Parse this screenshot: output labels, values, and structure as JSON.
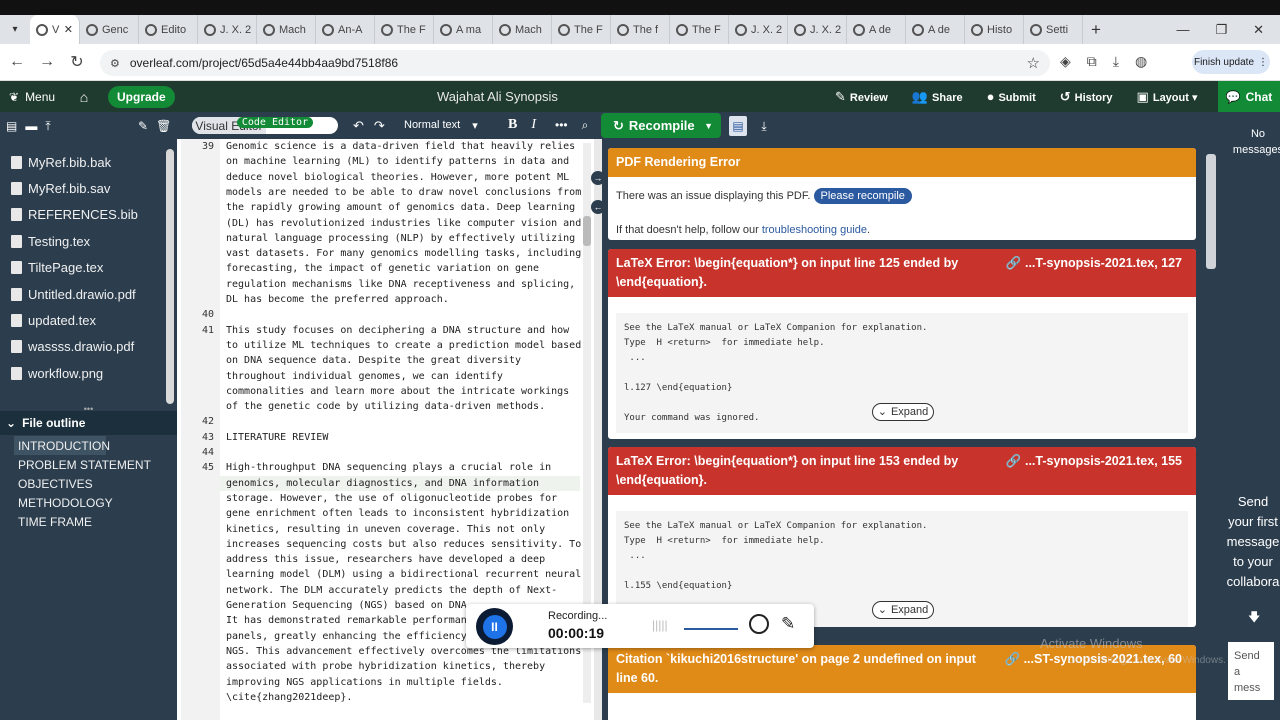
{
  "browser": {
    "tabs": [
      {
        "label": "V",
        "active": true
      },
      {
        "label": "Genc"
      },
      {
        "label": "Edito"
      },
      {
        "label": "J. X. 2"
      },
      {
        "label": "Mach"
      },
      {
        "label": "An-A"
      },
      {
        "label": "The F"
      },
      {
        "label": "A ma"
      },
      {
        "label": "Mach"
      },
      {
        "label": "The F"
      },
      {
        "label": "The f"
      },
      {
        "label": "The F"
      },
      {
        "label": "J. X. 2"
      },
      {
        "label": "J. X. 2"
      },
      {
        "label": "A de"
      },
      {
        "label": "A de"
      },
      {
        "label": "Histo"
      },
      {
        "label": "Setti"
      }
    ],
    "url": "overleaf.com/project/65d5a4e44bb4aa9bd7518f86",
    "finish_update": "Finish update"
  },
  "toolbar": {
    "menu": "Menu",
    "upgrade": "Upgrade",
    "project_title": "Wajahat Ali Synopsis",
    "review": "Review",
    "share": "Share",
    "submit": "Submit",
    "history": "History",
    "layout": "Layout",
    "chat": "Chat"
  },
  "subtoolbar": {
    "code_editor": "Code Editor",
    "visual_editor": "Visual Editor",
    "normal_text": "Normal text",
    "bold": "B",
    "italic": "I",
    "recompile": "Recompile"
  },
  "files": [
    "MyRef.bib.bak",
    "MyRef.bib.sav",
    "REFERENCES.bib",
    "Testing.tex",
    "TiltePage.tex",
    "Untitled.drawio.pdf",
    "updated.tex",
    "wassss.drawio.pdf",
    "workflow.png"
  ],
  "outline": {
    "title": "File outline",
    "items": [
      "INTRODUCTION",
      "PROBLEM STATEMENT",
      "OBJECTIVES",
      "METHODOLOGY",
      "TIME FRAME"
    ]
  },
  "editor": {
    "lines": [
      {
        "n": "39",
        "t": "Genomic science is a data-driven field that heavily relies"
      },
      {
        "n": "",
        "t": "on machine learning (ML) to identify patterns in data and"
      },
      {
        "n": "",
        "t": "deduce novel biological theories. However, more potent ML"
      },
      {
        "n": "",
        "t": "models are needed to be able to draw novel conclusions from"
      },
      {
        "n": "",
        "t": "the rapidly growing amount of genomics data. Deep learning"
      },
      {
        "n": "",
        "t": "(DL) has revolutionized industries like computer vision and"
      },
      {
        "n": "",
        "t": "natural language processing (NLP) by effectively utilizing"
      },
      {
        "n": "",
        "t": "vast datasets. For many genomics modelling tasks, including"
      },
      {
        "n": "",
        "t": "forecasting, the impact of genetic variation on gene"
      },
      {
        "n": "",
        "t": "regulation mechanisms like DNA receptiveness and splicing,"
      },
      {
        "n": "",
        "t": "DL has become the preferred approach."
      },
      {
        "n": "40",
        "t": ""
      },
      {
        "n": "41",
        "t": "This study focuses on deciphering a DNA structure and how"
      },
      {
        "n": "",
        "t": "to utilize ML techniques to create a prediction model based"
      },
      {
        "n": "",
        "t": "on DNA sequence data. Despite the great diversity"
      },
      {
        "n": "",
        "t": "throughout individual genomes, we can identify"
      },
      {
        "n": "",
        "t": "commonalities and learn more about the intricate workings"
      },
      {
        "n": "",
        "t": "of the genetic code by utilizing data-driven methods."
      },
      {
        "n": "42",
        "t": ""
      },
      {
        "n": "43",
        "t": "LITERATURE REVIEW"
      },
      {
        "n": "44",
        "t": ""
      },
      {
        "n": "45",
        "t": "High-throughput DNA sequencing plays a crucial role in"
      },
      {
        "n": "",
        "t": "genomics, molecular diagnostics, and DNA information"
      },
      {
        "n": "",
        "t": "storage. However, the use of oligonucleotide probes for"
      },
      {
        "n": "",
        "t": "gene enrichment often leads to inconsistent hybridization"
      },
      {
        "n": "",
        "t": "kinetics, resulting in uneven coverage. This not only"
      },
      {
        "n": "",
        "t": "increases sequencing costs but also reduces sensitivity. To"
      },
      {
        "n": "",
        "t": "address this issue, researchers have developed a deep"
      },
      {
        "n": "",
        "t": "learning model (DLM) using a bidirectional recurrent neural"
      },
      {
        "n": "",
        "t": "network. The DLM accurately predicts the depth of Next-"
      },
      {
        "n": "",
        "t": "Generation Sequencing (NGS) based on DNA"
      },
      {
        "n": "",
        "t": "It has demonstrated remarkable performanc"
      },
      {
        "n": "",
        "t": "panels, greatly enhancing the efficiency"
      },
      {
        "n": "",
        "t": "NGS. This advancement effectively overcomes the limitations"
      },
      {
        "n": "",
        "t": "associated with probe hybridization kinetics, thereby"
      },
      {
        "n": "",
        "t": "improving NGS applications in multiple fields."
      },
      {
        "n": "",
        "t": "\\cite{zhang2021deep}."
      }
    ]
  },
  "logs": {
    "pdf_error": {
      "title": "PDF Rendering Error",
      "text": "There was an issue displaying this PDF.",
      "button": "Please recompile",
      "help_prefix": "If that doesn't help, follow our ",
      "help_link": "troubleshooting guide",
      "help_suffix": "."
    },
    "errors": [
      {
        "title": "LaTeX Error: \\begin{equation*} on input line 125 ended by \\end{equation}.",
        "ref": "...T-synopsis-2021.tex, 127",
        "log": "See the LaTeX manual or LaTeX Companion for explanation.\nType  H <return>  for immediate help.\n ...\n\nl.127 \\end{equation}\n\nYour command was ignored.",
        "expand": "Expand"
      },
      {
        "title": "LaTeX Error: \\begin{equation*} on input line 153 ended by \\end{equation}.",
        "ref": "...T-synopsis-2021.tex, 155",
        "log": "See the LaTeX manual or LaTeX Companion for explanation.\nType  H <return>  for immediate help.\n ...\n\nl.155 \\end{equation}",
        "expand": "Expand"
      },
      {
        "title": "Citation `kikuchi2016structure' on page 2 undefined on input line 60.",
        "ref": "...ST-synopsis-2021.tex, 60"
      }
    ]
  },
  "chat": {
    "no_messages": "No messages",
    "prompt": "Send your first message to your collabora",
    "input_placeholder": "Send a mess"
  },
  "recording": {
    "label": "Recording...",
    "time": "00:00:19"
  },
  "watermark": {
    "title": "Activate Windows",
    "sub": "Go to Settings to activate Windows."
  }
}
